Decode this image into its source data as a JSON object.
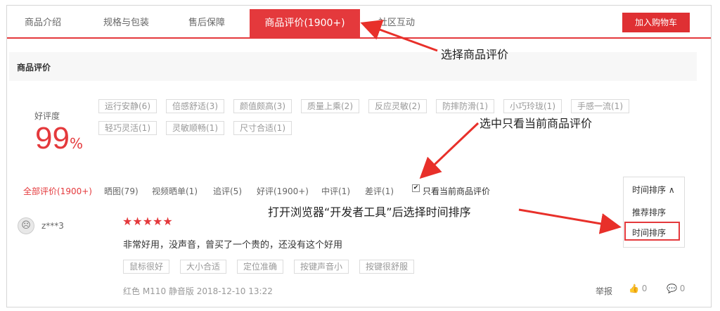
{
  "tabs": [
    "商品介绍",
    "规格与包装",
    "售后保障",
    "商品评价(1900+)",
    "社区互动"
  ],
  "cart_button": "加入购物车",
  "section_title": "商品评价",
  "rating": {
    "label": "好评度",
    "value": "99",
    "unit": "%"
  },
  "tags": [
    "运行安静(6)",
    "倍感舒适(3)",
    "颜值颇高(3)",
    "质量上乘(2)",
    "反应灵敏(2)",
    "防摔防滑(1)",
    "小巧玲珑(1)",
    "手感一流(1)",
    "轻巧灵活(1)",
    "灵敏顺畅(1)",
    "尺寸合适(1)"
  ],
  "filters": [
    "全部评价(1900+)",
    "晒图(79)",
    "视频晒单(1)",
    "追评(5)",
    "好评(1900+)",
    "中评(1)",
    "差评(1)"
  ],
  "only_current": {
    "label": "只看当前商品评价",
    "checked": true,
    "mark": "✔"
  },
  "sort": {
    "current": "时间排序",
    "caret": "∧",
    "options": [
      "推荐排序",
      "时间排序"
    ]
  },
  "comment": {
    "avatar": "☹",
    "user": "z***3",
    "stars": "★★★★★",
    "text": "非常好用，没声音，曾买了一个贵的，还没有这个好用",
    "tags": [
      "鼠标很好",
      "大小合适",
      "定位准确",
      "按键声音小",
      "按键很舒服"
    ],
    "meta": "红色    M110 静音版    2018-12-10 13:22",
    "report": "举报",
    "likes": "0",
    "replies": "0",
    "like_icon": "👍",
    "reply_icon": "💬"
  },
  "annotations": {
    "select_review": "选择商品评价",
    "select_only": "选中只看当前商品评价",
    "open_devtools": "打开浏览器“开发者工具”后选择时间排序"
  },
  "colors": {
    "accent": "#e4393c",
    "annotation_arrow": "#e8302a"
  }
}
